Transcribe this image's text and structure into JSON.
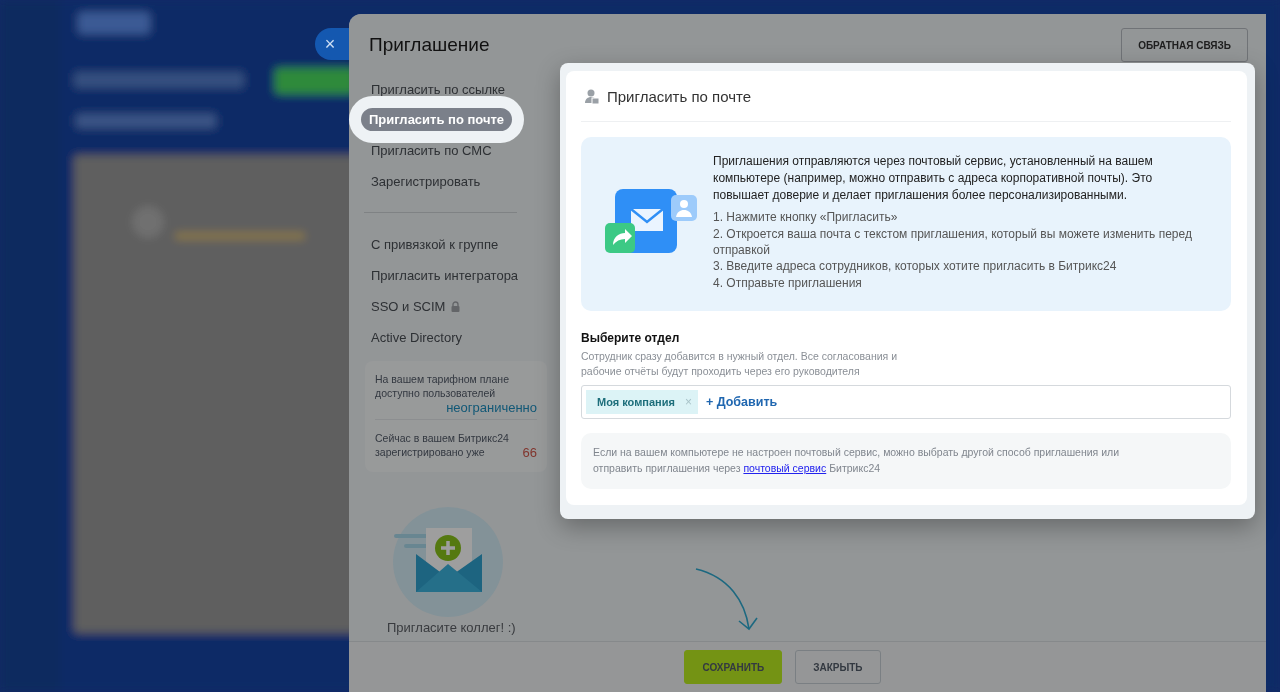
{
  "panel": {
    "title": "Приглашение",
    "feedback_button": "ОБРАТНАЯ СВЯЗЬ",
    "close_button": "×"
  },
  "menu": [
    {
      "items": [
        {
          "label": "Пригласить по ссылке",
          "selected": false,
          "locked": false
        },
        {
          "label": "Пригласить по почте",
          "selected": true,
          "locked": false
        },
        {
          "label": "Пригласить по СМС",
          "selected": false,
          "locked": false
        },
        {
          "label": "Зарегистрировать",
          "selected": false,
          "locked": false
        }
      ]
    },
    {
      "items": [
        {
          "label": "С привязкой к группе",
          "selected": false,
          "locked": false
        },
        {
          "label": "Пригласить интегратора",
          "selected": false,
          "locked": false
        },
        {
          "label": "SSO и SCIM",
          "selected": false,
          "locked": true
        },
        {
          "label": "Active Directory",
          "selected": false,
          "locked": false
        }
      ]
    }
  ],
  "plan_info": [
    {
      "label": "На вашем тарифном плане доступно пользователей",
      "value": "неограниченно",
      "kind": "limit"
    },
    {
      "label": "Сейчас в вашем Битрикс24 зарегистрировано уже",
      "value": "66",
      "kind": "count"
    }
  ],
  "illustration_caption": "Пригласите коллег! :)",
  "card": {
    "title": "Пригласить по почте",
    "intro": "Приглашения отправляются через почтовый сервис, установленный на вашем компьютере (например, можно отправить с адреса корпоративной почты). Это повышает доверие и делает приглашения более персонализированными.",
    "steps": [
      "1. Нажмите кнопку «Пригласить»",
      "2. Откроется ваша почта с текстом приглашения, который вы можете изменить перед отправкой",
      "3. Введите адреса сотрудников, которых хотите пригласить в Битрикс24",
      "4. Отправьте приглашения"
    ],
    "department": {
      "label": "Выберите отдел",
      "hint": "Сотрудник сразу добавится в нужный отдел. Все согласования и рабочие отчёты будут проходить через его руководителя",
      "tags": [
        {
          "label": "Моя компания",
          "remove": "×"
        }
      ],
      "add_link": "+ Добавить"
    },
    "note": {
      "text_before": "Если на вашем компьютере не настроен почтовый сервис, можно выбрать другой способ приглашения или отправить приглашения через",
      "link": "почтовый сервис",
      "text_after": "Битрикс24"
    }
  },
  "footer": {
    "buttons": [
      {
        "label": "СОХРАНИТЬ",
        "kind": "primary"
      },
      {
        "label": "ЗАКРЫТЬ",
        "kind": "secondary"
      }
    ]
  }
}
